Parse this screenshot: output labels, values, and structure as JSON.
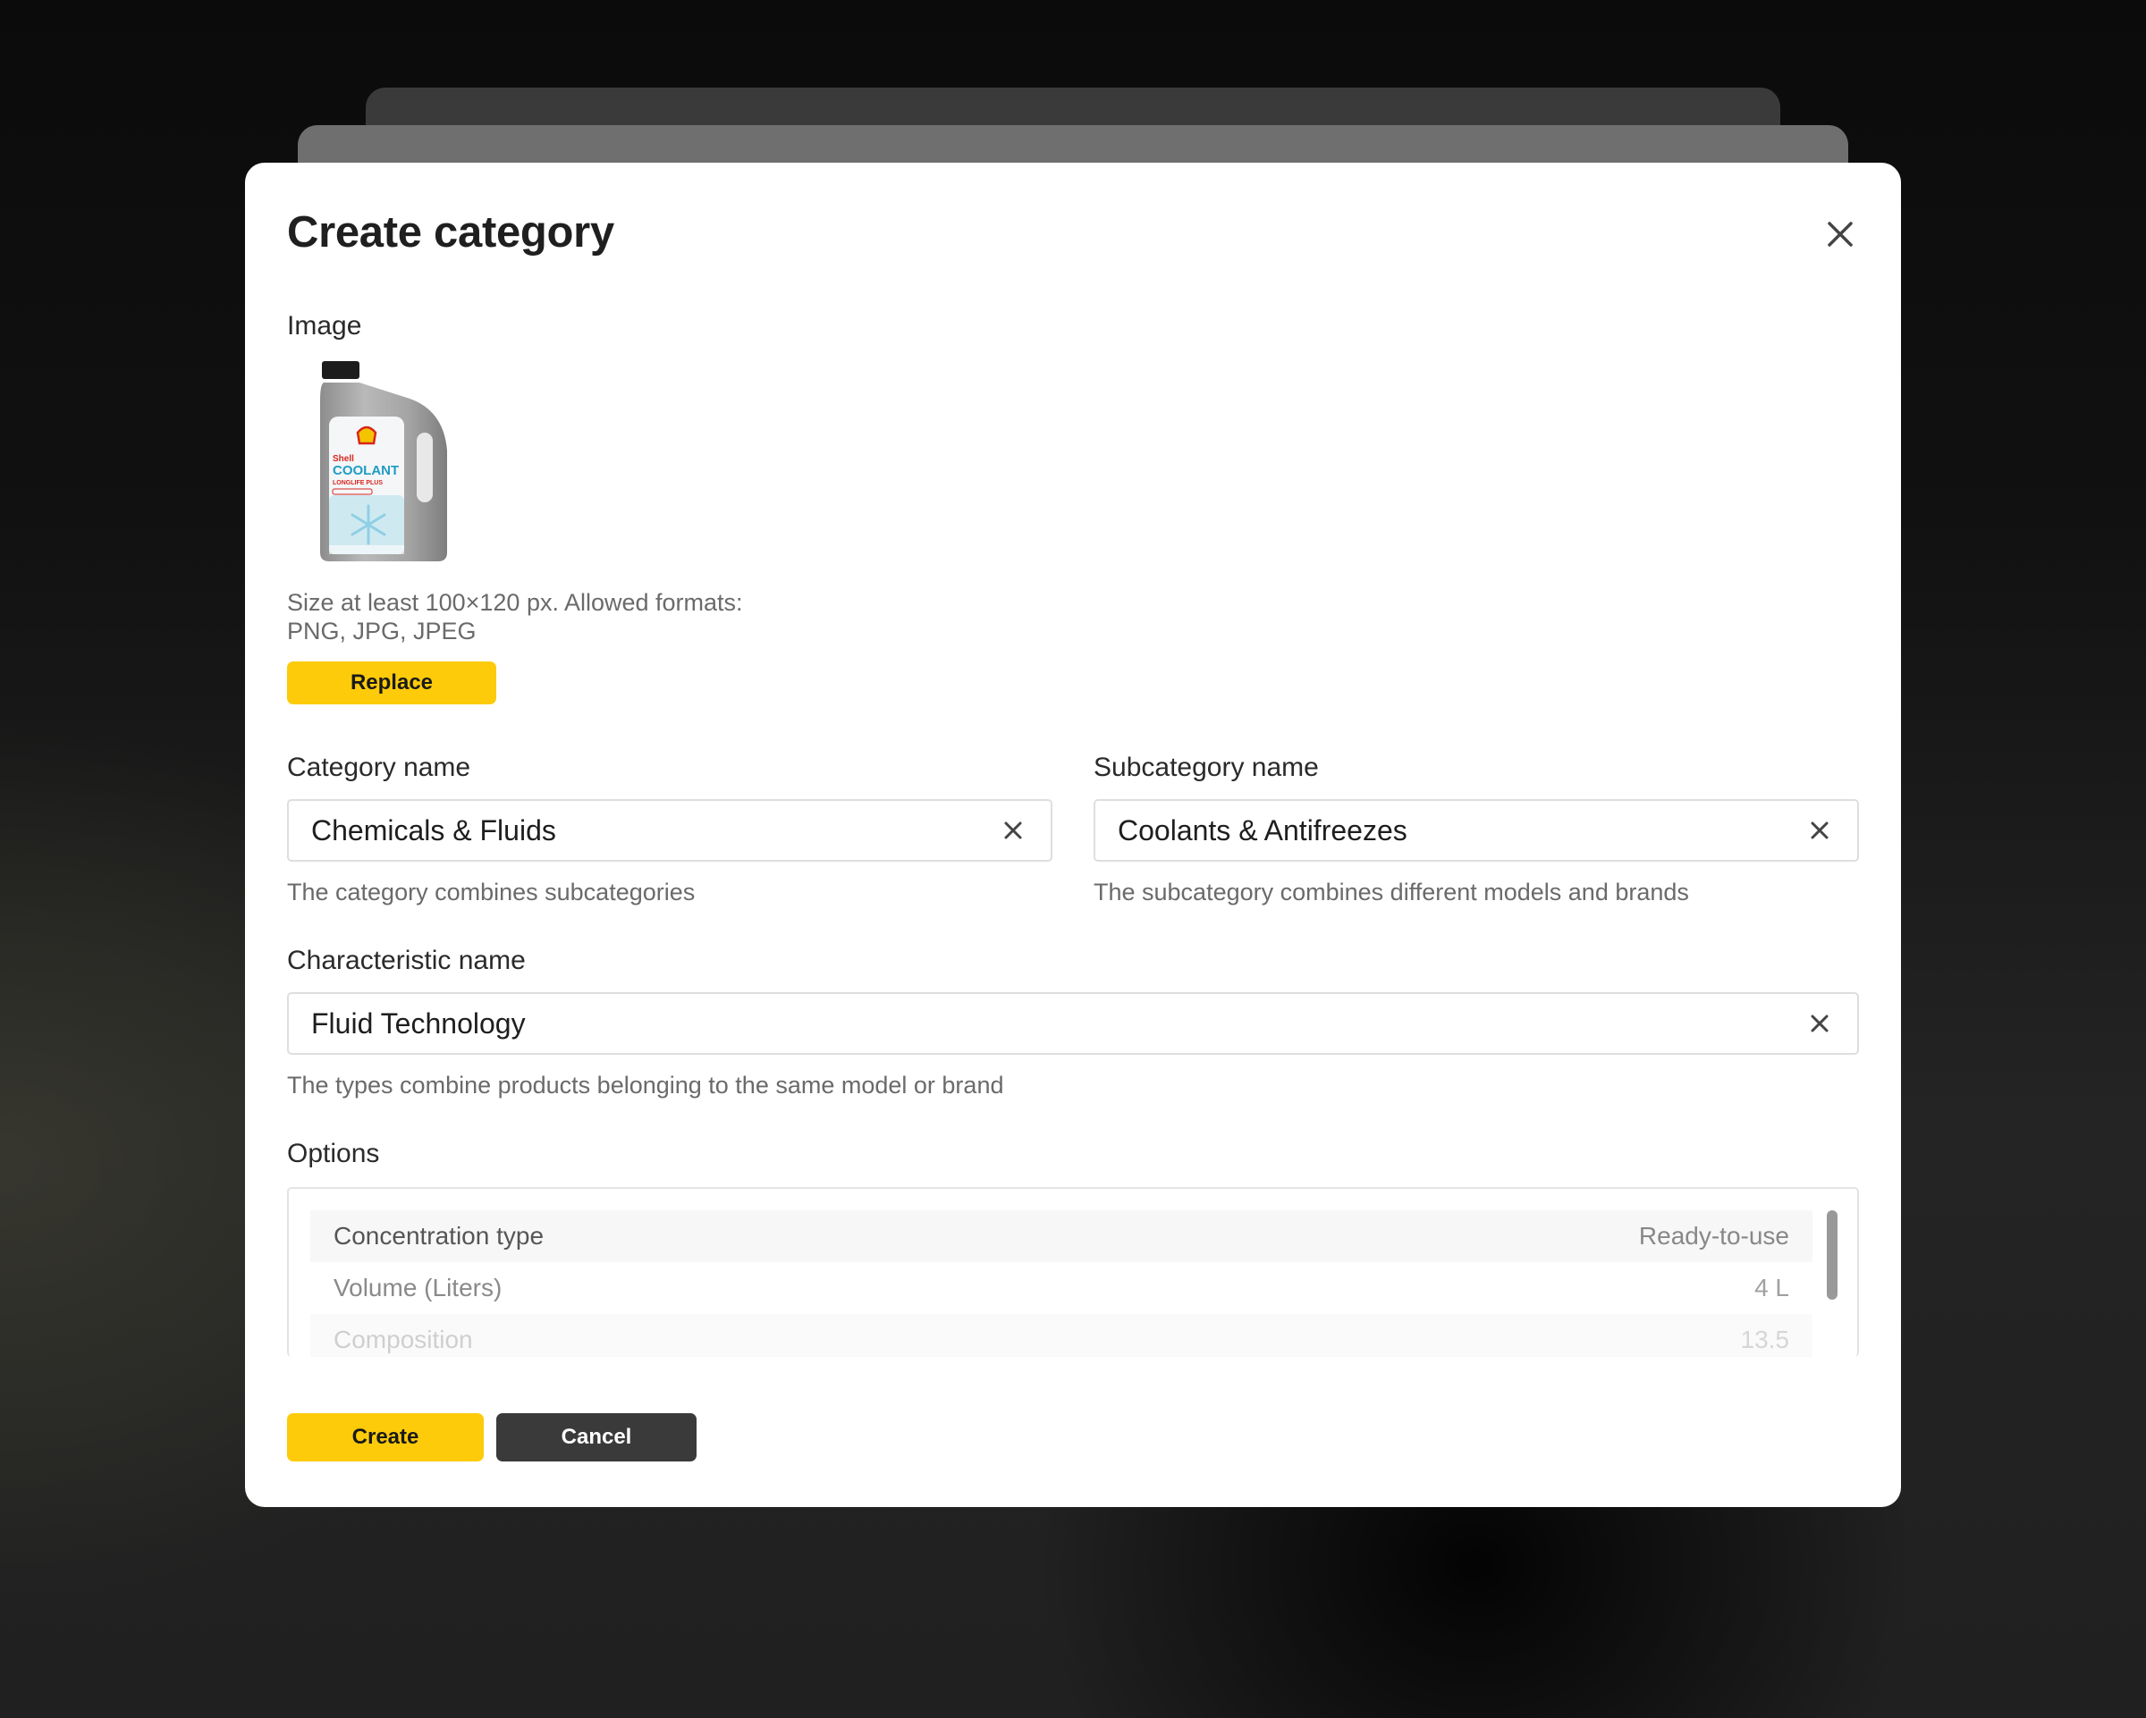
{
  "dialog": {
    "title": "Create category",
    "image_label": "Image",
    "image_hint_line1": "Size at least 100×120 px. Allowed formats:",
    "image_hint_line2": "PNG, JPG, JPEG",
    "replace_label": "Replace",
    "product_image": {
      "brand_text": "Shell",
      "product_text": "COOLANT",
      "product_subtext": "LONGLIFE PLUS"
    },
    "category": {
      "label": "Category name",
      "value": "Chemicals & Fluids",
      "hint": "The category combines subcategories"
    },
    "subcategory": {
      "label": "Subcategory name",
      "value": "Coolants & Antifreezes",
      "hint": "The subcategory combines different models and brands"
    },
    "characteristic": {
      "label": "Characteristic name",
      "value": "Fluid Technology",
      "hint": "The types combine products belonging to the same model or brand"
    },
    "options": {
      "label": "Options",
      "rows": [
        {
          "name": "Concentration type",
          "value": "Ready-to-use"
        },
        {
          "name": "Volume (Liters)",
          "value": "4 L"
        },
        {
          "name": "Composition",
          "value": "13.5"
        }
      ]
    },
    "create_label": "Create",
    "cancel_label": "Cancel"
  },
  "colors": {
    "accent": "#fdcb0a",
    "dark_button": "#3a3a3a",
    "background": "#111111"
  }
}
